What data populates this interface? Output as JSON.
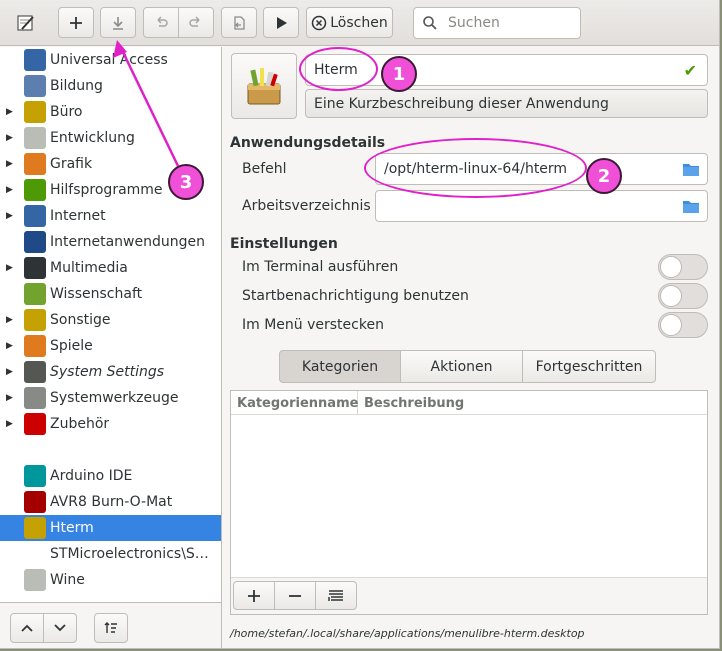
{
  "header": {
    "delete_label": "Löschen",
    "search_placeholder": "Suchen",
    "icons": [
      "add-icon",
      "download-icon",
      "undo-icon",
      "redo-icon",
      "revert-icon",
      "run-icon",
      "delete-icon",
      "search-icon"
    ]
  },
  "sidebar": {
    "categories": [
      {
        "label": "Universal Access",
        "expandable": false,
        "icon": "accessibility-icon",
        "color": "#3465a4"
      },
      {
        "label": "Bildung",
        "expandable": false,
        "icon": "education-icon",
        "color": "#5c7fb0"
      },
      {
        "label": "Büro",
        "expandable": true,
        "icon": "office-icon",
        "color": "#c4a000"
      },
      {
        "label": "Entwicklung",
        "expandable": true,
        "icon": "development-icon",
        "color": "#babdb6"
      },
      {
        "label": "Grafik",
        "expandable": true,
        "icon": "graphics-icon",
        "color": "#e07a1f"
      },
      {
        "label": "Hilfsprogramme",
        "expandable": true,
        "icon": "utilities-icon",
        "color": "#4e9a06"
      },
      {
        "label": "Internet",
        "expandable": true,
        "icon": "internet-icon",
        "color": "#3465a4"
      },
      {
        "label": "Internetanwendungen",
        "expandable": false,
        "icon": "web-apps-icon",
        "color": "#204a87"
      },
      {
        "label": "Multimedia",
        "expandable": true,
        "icon": "multimedia-icon",
        "color": "#2e3436"
      },
      {
        "label": "Wissenschaft",
        "expandable": false,
        "icon": "science-icon",
        "color": "#73a32f"
      },
      {
        "label": "Sonstige",
        "expandable": true,
        "icon": "other-icon",
        "color": "#c4a000"
      },
      {
        "label": "Spiele",
        "expandable": true,
        "icon": "games-icon",
        "color": "#e07a1f"
      },
      {
        "label": "System Settings",
        "expandable": true,
        "italic": true,
        "icon": "system-settings-icon",
        "color": "#555753"
      },
      {
        "label": "Systemwerkzeuge",
        "expandable": true,
        "icon": "system-tools-icon",
        "color": "#888a85"
      },
      {
        "label": "Zubehör",
        "expandable": true,
        "icon": "accessories-icon",
        "color": "#cc0000"
      }
    ],
    "apps": [
      {
        "label": "Arduino IDE",
        "icon": "arduino-icon",
        "color": "#00979c",
        "selected": false
      },
      {
        "label": "AVR8 Burn-O-Mat",
        "icon": "avr8-icon",
        "color": "#a40000",
        "selected": false
      },
      {
        "label": "Hterm",
        "icon": "hterm-icon",
        "color": "#c4a000",
        "selected": true
      },
      {
        "label": "STMicroelectronics\\ST...",
        "icon": "",
        "color": "",
        "selected": false
      },
      {
        "label": "Wine",
        "icon": "wine-icon",
        "color": "#babdb6",
        "selected": false
      }
    ],
    "footer_icons": [
      "move-up-icon",
      "move-down-icon",
      "sort-icon"
    ]
  },
  "editor": {
    "name_value": "Hterm",
    "description_value": "Eine Kurzbeschreibung dieser Anwendung",
    "details_title": "Anwendungsdetails",
    "command_label": "Befehl",
    "command_value": "/opt/hterm-linux-64/hterm",
    "workdir_label": "Arbeitsverzeichnis",
    "workdir_value": "",
    "settings_title": "Einstellungen",
    "settings": [
      {
        "label": "Im Terminal ausführen",
        "on": false
      },
      {
        "label": "Startbenachrichtigung benutzen",
        "on": false
      },
      {
        "label": "Im Menü verstecken",
        "on": false
      }
    ],
    "tabs": [
      {
        "label": "Kategorien",
        "active": true
      },
      {
        "label": "Aktionen",
        "active": false
      },
      {
        "label": "Fortgeschritten",
        "active": false
      }
    ],
    "table_columns": [
      "Kategorienname",
      "Beschreibung"
    ],
    "table_toolbar_icons": [
      "add-icon",
      "remove-icon",
      "clear-icon"
    ],
    "file_path": "/home/stefan/.local/share/applications/menulibre-hterm.desktop"
  },
  "annotations": {
    "color": "#e020c8",
    "badges": [
      "1",
      "2",
      "3"
    ]
  }
}
